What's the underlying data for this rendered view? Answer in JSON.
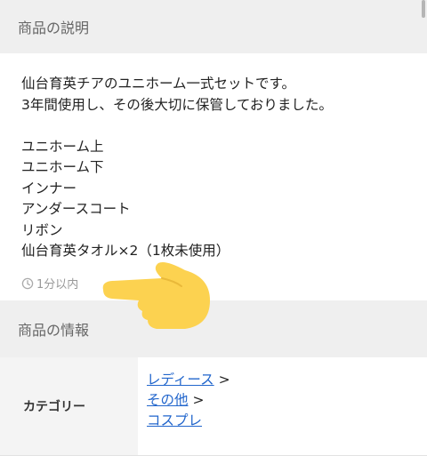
{
  "description_section": {
    "title": "商品の説明",
    "lines": [
      "仙台育英チアのユニホーム一式セットです。",
      "3年間使用し、その後大切に保管しておりました。",
      "",
      "ユニホーム上",
      "ユニホーム下",
      "インナー",
      "アンダースコート",
      "リボン",
      "仙台育英タオル×2（1枚未使用）"
    ],
    "timestamp": "1分以内",
    "timestamp_icon": "clock-icon",
    "sticker_icon": "pointing-hand-emoji"
  },
  "info_section": {
    "title": "商品の情報",
    "rows": [
      {
        "label": "カテゴリー",
        "links": [
          {
            "text": "レディース",
            "sep": ">"
          },
          {
            "text": "その他",
            "sep": ">"
          },
          {
            "text": "コスプレ",
            "sep": ""
          }
        ]
      }
    ]
  },
  "colors": {
    "link": "#2266cc",
    "header_bg": "#efefef",
    "emoji": "#fcd250"
  }
}
